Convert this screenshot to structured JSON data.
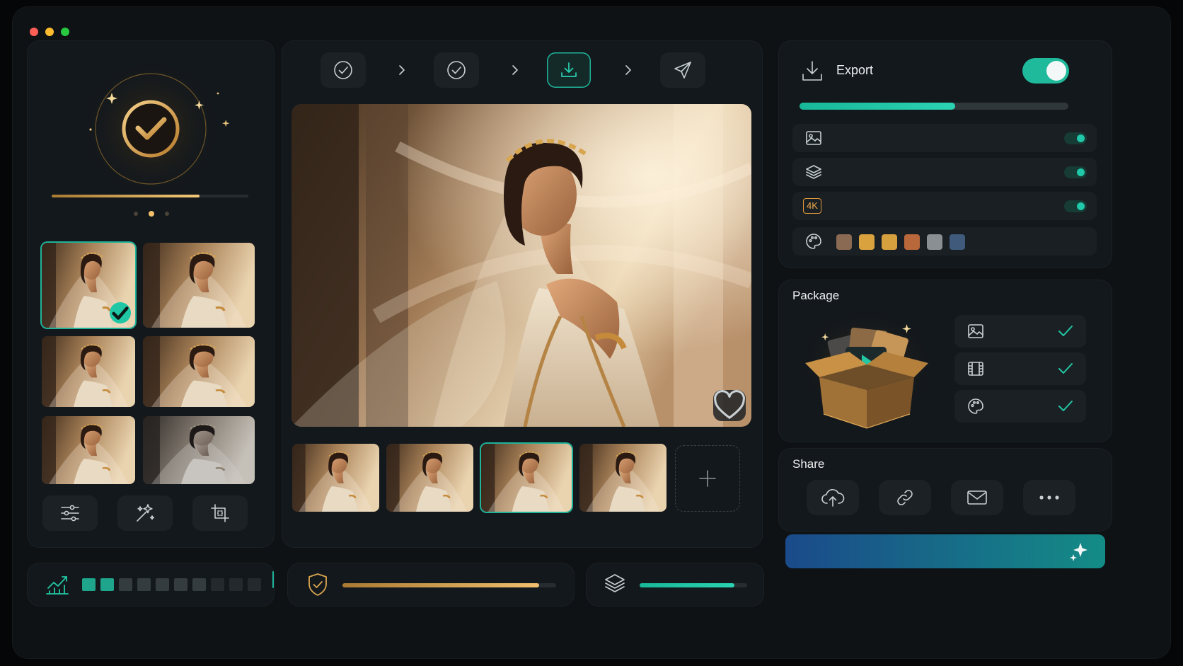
{
  "window": {
    "traffic_lights": [
      "#ff5f57",
      "#febc2e",
      "#28c840"
    ]
  },
  "left_panel": {
    "status_icon": "gold-check-badge-icon",
    "progress": 0.75,
    "carousel_dots": 3,
    "active_dot": 1,
    "thumbnails": [
      {
        "selected": true,
        "icon": "check-badge-icon"
      },
      {
        "selected": false
      },
      {
        "selected": false
      },
      {
        "selected": false
      },
      {
        "selected": false
      },
      {
        "selected": false,
        "desaturated": true
      }
    ],
    "tools": [
      "sliders-icon",
      "magic-sparkle-icon",
      "crop-icon"
    ]
  },
  "stepper": {
    "steps": [
      {
        "icon": "check-circle-icon",
        "state": "done"
      },
      {
        "icon": "check-circle-icon",
        "state": "done"
      },
      {
        "icon": "download-tray-icon",
        "state": "active"
      },
      {
        "icon": "send-icon",
        "state": "pending"
      }
    ],
    "separator_icon": "chevron-right-icon"
  },
  "preview": {
    "favorite_icon": "heart-icon",
    "filmstrip_count": 4,
    "filmstrip_selected": 2,
    "add_icon": "plus-icon"
  },
  "export": {
    "title": "Export",
    "enabled": true,
    "progress": 0.58,
    "options": [
      {
        "icon": "image-icon",
        "enabled": true
      },
      {
        "icon": "layers-icon",
        "enabled": true
      },
      {
        "badge": "4K",
        "enabled": true
      }
    ],
    "palette_icon": "palette-icon",
    "palette": [
      "#8a6a52",
      "#d9a23e",
      "#d6a03f",
      "#b8683a",
      "#8a8f94",
      "#3f5a7a"
    ]
  },
  "package": {
    "title": "Package",
    "illustration": "open-box-media-icon",
    "items": [
      {
        "icon": "image-icon",
        "checked": true
      },
      {
        "icon": "film-icon",
        "checked": true
      },
      {
        "icon": "palette-icon",
        "checked": true
      }
    ]
  },
  "share": {
    "title": "Share",
    "actions": [
      "cloud-upload-icon",
      "link-icon",
      "mail-icon",
      "more-icon"
    ]
  },
  "cta": {
    "icon": "sparkle-icon",
    "colors": [
      "#1a4a8a",
      "#148c86"
    ]
  },
  "status_bar": {
    "analytics_icon": "chart-up-icon",
    "quality_blocks_total": 10,
    "quality_blocks_filled": 2,
    "shield_icon": "shield-check-icon",
    "shield_progress": 0.92,
    "layers_icon": "layers-icon",
    "layers_progress": 0.88
  }
}
